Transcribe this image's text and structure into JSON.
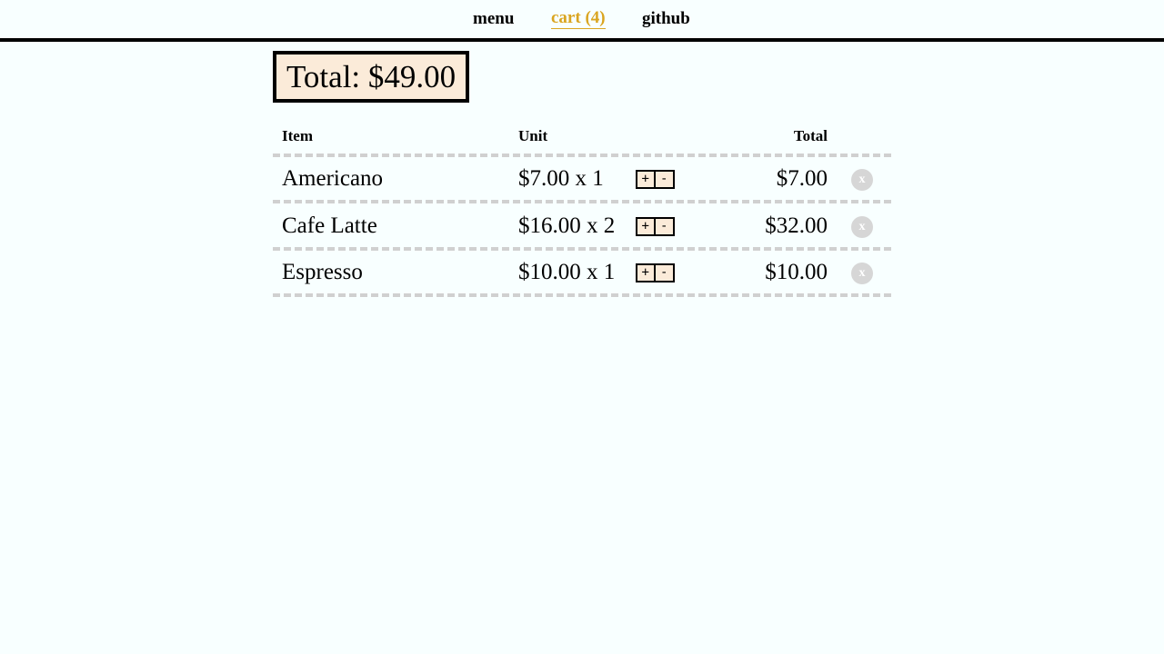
{
  "nav": {
    "menu_label": "menu",
    "cart_label": "cart (4)",
    "github_label": "github",
    "active_color": "#daa520"
  },
  "cart": {
    "total_label": "Total: $49.00",
    "columns": {
      "item": "Item",
      "unit": "Unit",
      "total": "Total"
    },
    "rows": [
      {
        "item": "Americano",
        "unit": "$7.00 x 1",
        "total": "$7.00"
      },
      {
        "item": "Cafe Latte",
        "unit": "$16.00 x 2",
        "total": "$32.00"
      },
      {
        "item": "Espresso",
        "unit": "$10.00 x 1",
        "total": "$10.00"
      }
    ],
    "controls": {
      "increment": "+",
      "decrement": "-",
      "remove": "x"
    }
  }
}
